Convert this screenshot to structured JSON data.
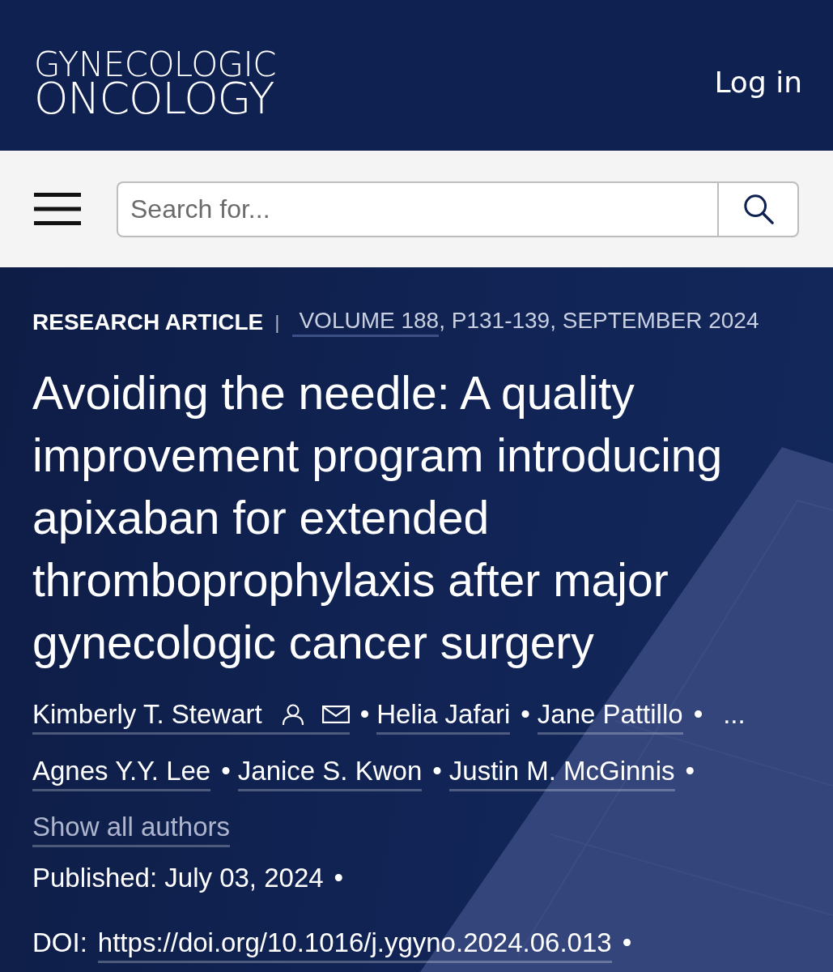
{
  "header": {
    "logo": {
      "line_1": "GYNECOLOGIC",
      "line_2": "ONCOLOGY"
    },
    "login": "Log in"
  },
  "toolbar": {
    "search": {
      "placeholder": "Search for..."
    }
  },
  "article": {
    "meta": {
      "type": "RESEARCH ARTICLE",
      "separator": "|",
      "volume": "VOLUME 188",
      "details": ", P131-139, SEPTEMBER 2024"
    },
    "title": "Avoiding the needle: A quality improvement program introducing apixaban for extended thromboprophylaxis after major gynecologic cancer surgery",
    "authors": [
      {
        "kind": "author",
        "name": "Kimberly T. Stewart",
        "corresponding": true,
        "separator": "•"
      },
      {
        "kind": "author",
        "name": "Helia Jafari",
        "corresponding": false,
        "separator": "•"
      },
      {
        "kind": "author",
        "name": "Jane Pattillo",
        "corresponding": false,
        "separator": "•"
      },
      {
        "kind": "ellipsis",
        "text": "..."
      },
      {
        "kind": "author",
        "name": "Agnes Y.Y. Lee",
        "corresponding": false,
        "separator": "•"
      },
      {
        "kind": "author",
        "name": "Janice S. Kwon",
        "corresponding": false,
        "separator": "•"
      },
      {
        "kind": "author",
        "name": "Justin M. McGinnis",
        "corresponding": false,
        "separator": "•"
      }
    ],
    "show_all": "Show all authors",
    "published": {
      "text": "Published: July 03, 2024",
      "separator": "•"
    },
    "doi": {
      "label": "DOI:",
      "link": "https://doi.org/10.1016/j.ygyno.2024.06.013",
      "separator": "•"
    }
  }
}
